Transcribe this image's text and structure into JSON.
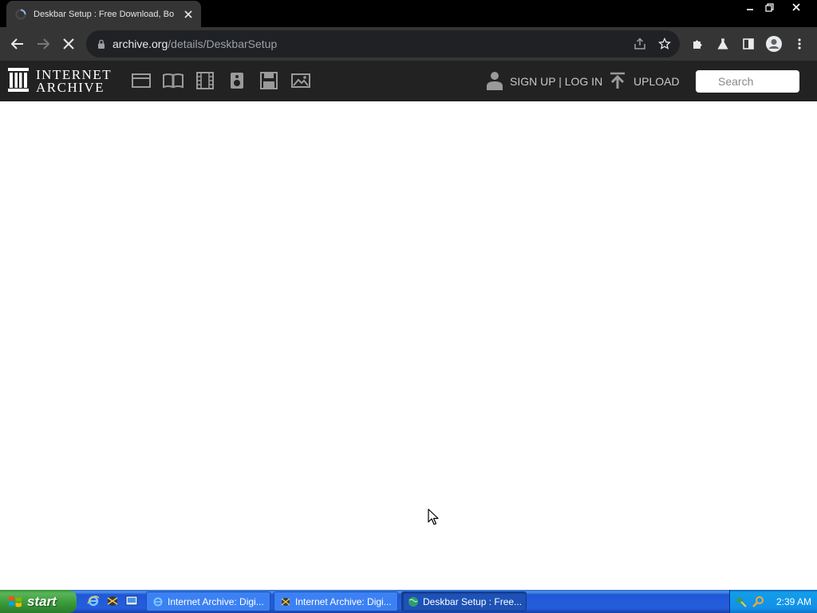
{
  "browser": {
    "tab": {
      "title": "Deskbar Setup : Free Download, Bo"
    },
    "address": {
      "host": "archive.org",
      "path": "/details/DeskbarSetup"
    }
  },
  "ia_nav": {
    "logo_line1": "INTERNET",
    "logo_line2": "ARCHIVE",
    "signup_label": "SIGN UP | LOG IN",
    "upload_label": "UPLOAD",
    "search_placeholder": "Search"
  },
  "taskbar": {
    "start_label": "start",
    "tasks": [
      {
        "label": "Internet Archive: Digi..."
      },
      {
        "label": "Internet Archive: Digi..."
      },
      {
        "label": "Deskbar Setup : Free..."
      }
    ],
    "clock": "2:39 AM"
  },
  "colors": {
    "chrome_frame": "#000000",
    "chrome_toolbar": "#353535",
    "ia_nav_bg": "#222222",
    "xp_taskbar": "#245edb",
    "xp_start": "#379937"
  }
}
